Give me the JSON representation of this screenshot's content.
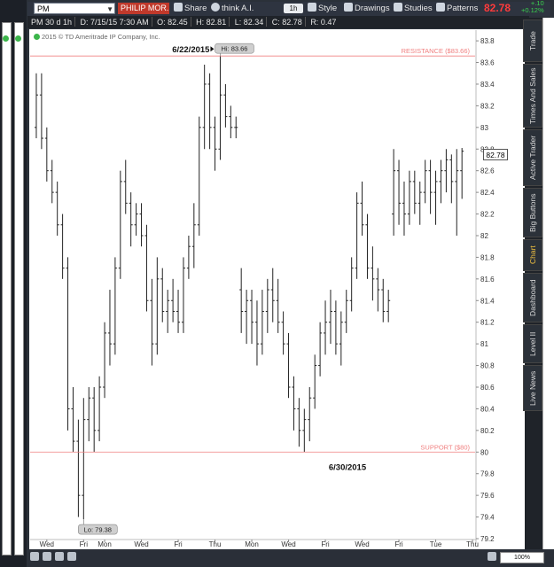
{
  "toolbar": {
    "symbol": "PM",
    "company": "PHILIP MOR...",
    "share_label": "Share",
    "thinkai_label": "think A.I.",
    "timeframe_label": "1h",
    "style_label": "Style",
    "drawings_label": "Drawings",
    "studies_label": "Studies",
    "patterns_label": "Patterns",
    "last_price": "82.78",
    "change": "+.10",
    "change_pct": "+0.12%"
  },
  "info_bar": {
    "symbol_period": "PM 30 d 1h",
    "date": "D: 7/15/15 7:30 AM",
    "open": "O: 82.45",
    "high": "H: 82.81",
    "low": "L: 82.34",
    "close": "C: 82.78",
    "range": "R: 0.47"
  },
  "copyright": "2015 © TD Ameritrade IP Company, Inc.",
  "side_tabs": [
    "Trade",
    "Times And Sales",
    "Active Trader",
    "Big Buttons",
    "Chart",
    "Dashboard",
    "Level II",
    "Live News"
  ],
  "active_tab": "Chart",
  "zoom_label": "100%",
  "colors": {
    "candle": "#222222",
    "resistance": "#f08080",
    "support": "#f08080",
    "last_price": "#ff3b3b",
    "change": "#3ad14e",
    "active_tab": "#f0c040"
  },
  "chart_data": {
    "type": "bar",
    "bar_style": "ohlc",
    "ylim": [
      79.2,
      83.85
    ],
    "y_ticks": [
      79.2,
      79.4,
      79.6,
      79.8,
      80,
      80.2,
      80.4,
      80.6,
      80.8,
      81,
      81.2,
      81.4,
      81.6,
      81.8,
      82,
      82.2,
      82.4,
      82.6,
      82.8,
      83,
      83.2,
      83.4,
      83.6,
      83.8
    ],
    "y_tick_labels": [
      "79.2",
      "79.4",
      "79.6",
      "79.8",
      "80",
      "80.2",
      "80.4",
      "80.6",
      "80.8",
      "81",
      "81.2",
      "81.4",
      "81.6",
      "81.8",
      "82",
      "82.2",
      "82.4",
      "82.6",
      "82.8",
      "83",
      "83.2",
      "83.4",
      "83.6",
      "83.8"
    ],
    "x_tick_labels": [
      "Wed",
      "Fri",
      "Mon",
      "Wed",
      "Fri",
      "Thu",
      "Mon",
      "Wed",
      "Fri",
      "Wed",
      "Fri",
      "Tue",
      "Thu"
    ],
    "x_tick_bars": [
      2,
      9,
      13,
      20,
      27,
      34,
      41,
      48,
      55,
      62,
      69,
      76,
      83
    ],
    "bar_count": 84,
    "bars": [
      [
        83.0,
        83.5,
        82.9,
        83.3
      ],
      [
        83.3,
        83.5,
        82.8,
        82.9
      ],
      [
        82.9,
        83.0,
        82.5,
        82.6
      ],
      [
        82.6,
        82.7,
        82.3,
        82.4
      ],
      [
        82.4,
        82.5,
        82.0,
        82.1
      ],
      [
        82.1,
        82.2,
        81.6,
        81.7
      ],
      [
        81.7,
        81.8,
        80.2,
        80.4
      ],
      [
        80.4,
        80.6,
        80.0,
        80.1
      ],
      [
        80.1,
        80.3,
        79.4,
        79.6
      ],
      [
        79.6,
        80.5,
        79.38,
        80.3
      ],
      [
        80.3,
        80.6,
        80.1,
        80.5
      ],
      [
        80.5,
        80.6,
        80.0,
        80.2
      ],
      [
        80.2,
        80.7,
        80.1,
        80.6
      ],
      [
        80.6,
        81.2,
        80.5,
        81.1
      ],
      [
        81.1,
        81.5,
        80.8,
        81.0
      ],
      [
        81.0,
        81.8,
        80.9,
        81.7
      ],
      [
        81.7,
        82.6,
        81.6,
        82.5
      ],
      [
        82.5,
        82.7,
        82.2,
        82.3
      ],
      [
        82.3,
        82.4,
        81.9,
        82.1
      ],
      [
        82.1,
        82.3,
        82.0,
        82.2
      ],
      [
        82.2,
        82.3,
        81.9,
        82.0
      ],
      [
        82.0,
        82.1,
        81.3,
        81.4
      ],
      [
        81.4,
        81.6,
        80.8,
        81.0
      ],
      [
        81.0,
        81.8,
        80.9,
        81.6
      ],
      [
        81.6,
        81.7,
        81.2,
        81.3
      ],
      [
        81.3,
        81.5,
        81.1,
        81.4
      ],
      [
        81.4,
        81.6,
        81.2,
        81.3
      ],
      [
        81.3,
        81.5,
        81.1,
        81.2
      ],
      [
        81.2,
        81.8,
        81.1,
        81.7
      ],
      [
        81.7,
        82.0,
        81.6,
        81.9
      ],
      [
        81.9,
        82.3,
        81.7,
        82.1
      ],
      [
        82.1,
        83.1,
        82.0,
        83.0
      ],
      [
        83.0,
        83.58,
        82.8,
        83.4
      ],
      [
        83.4,
        83.5,
        82.8,
        83.0
      ],
      [
        83.0,
        83.1,
        82.6,
        82.8
      ],
      [
        82.8,
        83.66,
        82.7,
        83.3
      ],
      [
        83.3,
        83.4,
        83.0,
        83.1
      ],
      [
        83.1,
        83.2,
        82.9,
        83.0
      ],
      [
        83.0,
        83.1,
        82.9,
        83.0
      ],
      [
        81.5,
        81.7,
        81.1,
        81.3
      ],
      [
        81.3,
        81.5,
        81.0,
        81.4
      ],
      [
        81.4,
        81.5,
        81.0,
        81.2
      ],
      [
        81.2,
        81.4,
        80.8,
        81.0
      ],
      [
        81.0,
        81.5,
        80.9,
        81.3
      ],
      [
        81.3,
        81.6,
        81.1,
        81.5
      ],
      [
        81.5,
        81.7,
        81.2,
        81.4
      ],
      [
        81.4,
        81.6,
        81.1,
        81.2
      ],
      [
        81.2,
        81.3,
        80.9,
        81.0
      ],
      [
        81.0,
        81.1,
        80.5,
        80.6
      ],
      [
        80.6,
        80.7,
        80.2,
        80.4
      ],
      [
        80.4,
        80.5,
        80.05,
        80.2
      ],
      [
        80.2,
        80.4,
        80.0,
        80.3
      ],
      [
        80.3,
        80.6,
        80.1,
        80.5
      ],
      [
        80.5,
        80.9,
        80.4,
        80.8
      ],
      [
        80.8,
        81.2,
        80.7,
        81.1
      ],
      [
        81.1,
        81.4,
        80.9,
        81.2
      ],
      [
        81.2,
        81.5,
        81.0,
        81.3
      ],
      [
        81.3,
        81.4,
        80.9,
        81.0
      ],
      [
        81.0,
        81.3,
        80.8,
        81.2
      ],
      [
        81.2,
        81.5,
        81.1,
        81.4
      ],
      [
        81.4,
        81.8,
        81.3,
        81.7
      ],
      [
        81.7,
        82.4,
        81.6,
        82.3
      ],
      [
        82.3,
        82.5,
        82.0,
        82.1
      ],
      [
        82.1,
        82.2,
        81.6,
        81.7
      ],
      [
        81.7,
        81.9,
        81.4,
        81.6
      ],
      [
        81.6,
        81.7,
        81.3,
        81.5
      ],
      [
        81.5,
        81.6,
        81.2,
        81.3
      ],
      [
        81.3,
        81.5,
        81.2,
        81.4
      ],
      [
        82.2,
        82.8,
        82.0,
        82.6
      ],
      [
        82.6,
        82.7,
        82.1,
        82.3
      ],
      [
        82.3,
        82.5,
        82.0,
        82.2
      ],
      [
        82.2,
        82.6,
        82.1,
        82.5
      ],
      [
        82.5,
        82.6,
        82.2,
        82.3
      ],
      [
        82.3,
        82.5,
        82.1,
        82.4
      ],
      [
        82.4,
        82.7,
        82.3,
        82.6
      ],
      [
        82.6,
        82.7,
        82.2,
        82.4
      ],
      [
        82.4,
        82.6,
        82.1,
        82.5
      ],
      [
        82.5,
        82.7,
        82.3,
        82.6
      ],
      [
        82.6,
        82.8,
        82.4,
        82.7
      ],
      [
        82.7,
        82.75,
        82.3,
        82.5
      ],
      [
        82.5,
        82.8,
        82.0,
        82.6
      ],
      [
        82.6,
        82.81,
        82.34,
        82.78
      ]
    ],
    "lines": [
      {
        "name": "RESISTANCE ($83.66)",
        "value": 83.66
      },
      {
        "name": "SUPPORT ($80)",
        "value": 80.0
      }
    ],
    "annotations": {
      "high_label": "Hi: 83.66",
      "low_label": "Lo: 79.38",
      "date_high": "6/22/2015",
      "date_low": "6/30/2015"
    },
    "price_flag": "82.78"
  }
}
